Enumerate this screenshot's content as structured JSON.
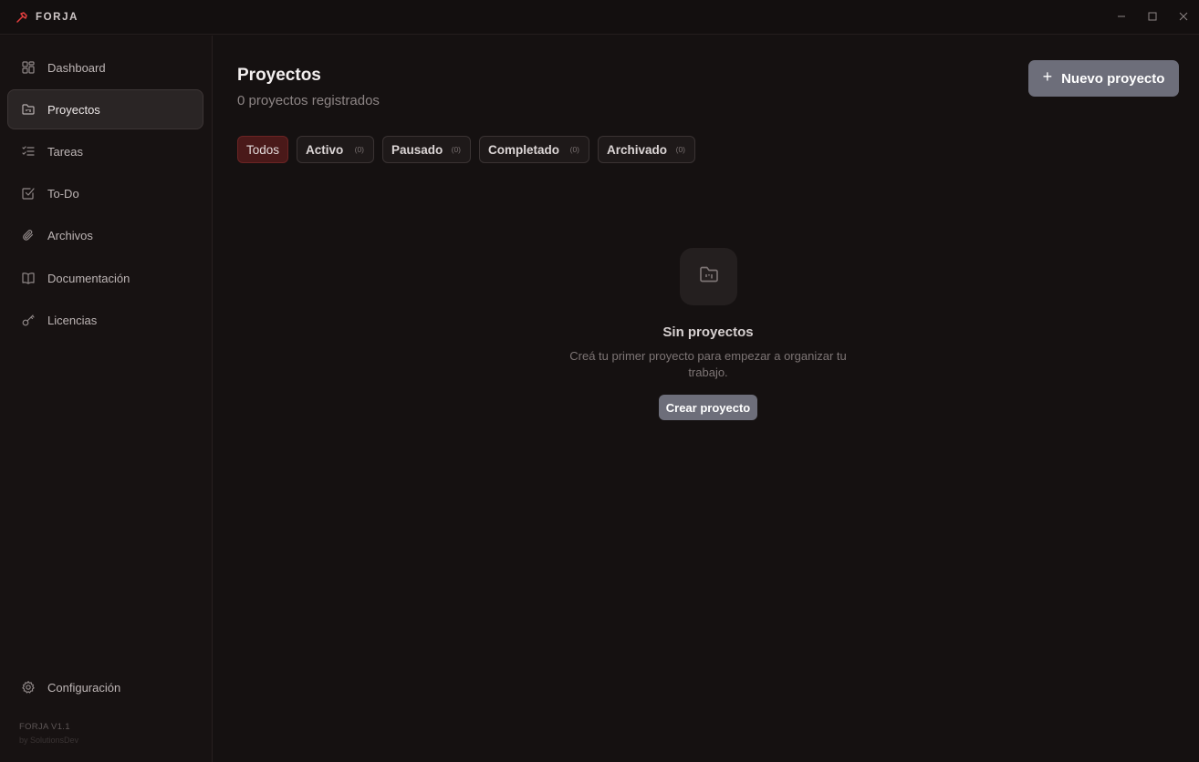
{
  "app": {
    "brand": "FORJA",
    "accent_color": "#e53e3e",
    "version": "FORJA V1.1",
    "by": "by SolutionsDev"
  },
  "window_controls": {
    "minimize_icon": "minimize-icon",
    "maximize_icon": "maximize-icon",
    "close_icon": "close-icon"
  },
  "sidebar": {
    "items": [
      {
        "label": "Dashboard",
        "icon": "dashboard-icon"
      },
      {
        "label": "Proyectos",
        "icon": "folder-kanban-icon",
        "active": true
      },
      {
        "label": "Tareas",
        "icon": "list-checks-icon"
      },
      {
        "label": "To-Do",
        "icon": "check-square-icon"
      },
      {
        "label": "Archivos",
        "icon": "paperclip-icon"
      },
      {
        "label": "Documentación",
        "icon": "book-icon"
      },
      {
        "label": "Licencias",
        "icon": "key-icon"
      }
    ],
    "settings": {
      "label": "Configuración",
      "icon": "gear-icon"
    }
  },
  "main": {
    "title": "Proyectos",
    "subtitle": "0 proyectos registrados",
    "new_button": "Nuevo proyecto",
    "filters": [
      {
        "label": "Todos",
        "count": "",
        "active": true
      },
      {
        "label": "Activo",
        "count": "(0)"
      },
      {
        "label": "Pausado",
        "count": "(0)"
      },
      {
        "label": "Completado",
        "count": "(0)"
      },
      {
        "label": "Archivado",
        "count": "(0)"
      }
    ],
    "empty": {
      "icon": "folder-kanban-icon",
      "title": "Sin proyectos",
      "description": "Creá tu primer proyecto para empezar a organizar tu trabajo.",
      "button": "Crear proyecto"
    }
  }
}
